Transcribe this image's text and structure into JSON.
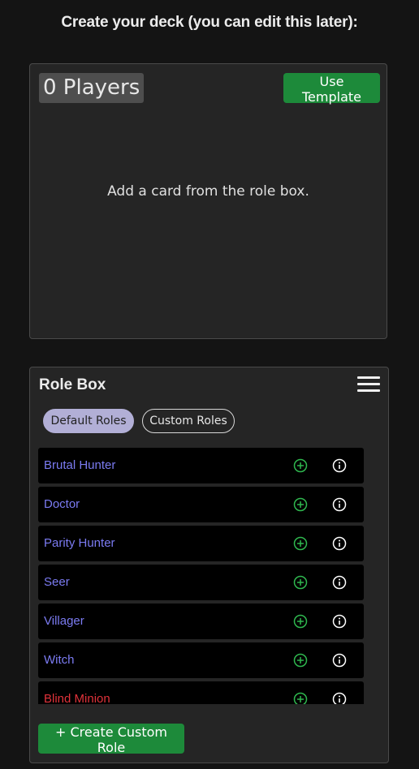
{
  "page": {
    "heading": "Create your deck (you can edit this later):"
  },
  "deck": {
    "player_count": "0 Players",
    "use_template_label": "Use Template",
    "empty_message": "Add a card from the role box."
  },
  "role_box": {
    "title": "Role Box",
    "menu_icon": "hamburger-menu-icon",
    "tabs": [
      {
        "label": "Default Roles",
        "active": true
      },
      {
        "label": "Custom Roles",
        "active": false
      }
    ],
    "roles": [
      {
        "name": "Brutal Hunter",
        "team_color": "#7b7bf2"
      },
      {
        "name": "Doctor",
        "team_color": "#7b7bf2"
      },
      {
        "name": "Parity Hunter",
        "team_color": "#7b7bf2"
      },
      {
        "name": "Seer",
        "team_color": "#7b7bf2"
      },
      {
        "name": "Villager",
        "team_color": "#7b7bf2"
      },
      {
        "name": "Witch",
        "team_color": "#7b7bf2"
      },
      {
        "name": "Blind Minion",
        "team_color": "#e0323a"
      }
    ],
    "add_icon": "plus-circle-icon",
    "info_icon": "info-circle-icon",
    "create_custom_label": "+ Create Custom Role"
  },
  "colors": {
    "background": "#141414",
    "panel": "#252525",
    "accent_green": "#1d8a3a",
    "add_icon_green": "#2fb84f",
    "village_team": "#7b7bf2",
    "wolf_team": "#e0323a",
    "tab_active": "#b2afd6"
  }
}
